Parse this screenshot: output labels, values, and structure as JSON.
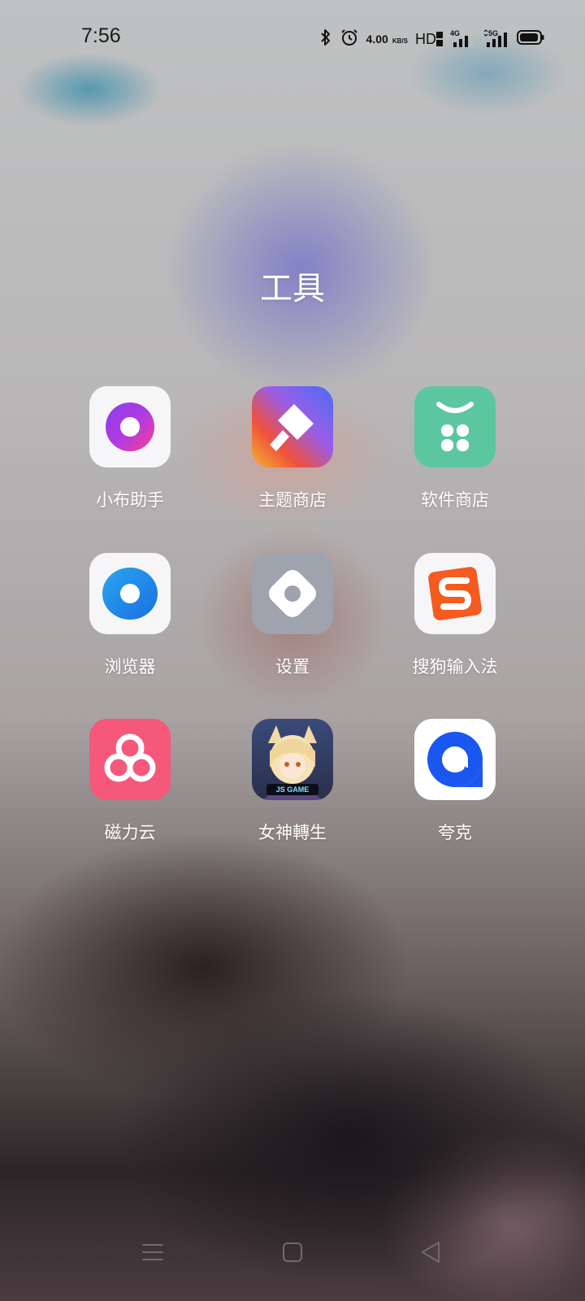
{
  "status_bar": {
    "time": "7:56",
    "net_speed_value": "4.00",
    "net_speed_unit": "KB/S",
    "hd_label": "HD",
    "signal_1_label": "4G",
    "signal_2_label": "5G",
    "icons": [
      "bluetooth-icon",
      "alarm-icon",
      "hd-volte-icon",
      "signal-4g-icon",
      "signal-5g-icon",
      "battery-icon"
    ]
  },
  "folder": {
    "title": "工具",
    "apps": [
      {
        "label": "小布助手",
        "icon": "xiaobu-assistant-icon"
      },
      {
        "label": "主题商店",
        "icon": "theme-store-icon"
      },
      {
        "label": "软件商店",
        "icon": "app-store-icon"
      },
      {
        "label": "浏览器",
        "icon": "browser-icon"
      },
      {
        "label": "设置",
        "icon": "settings-icon"
      },
      {
        "label": "搜狗输入法",
        "icon": "sogou-input-icon"
      },
      {
        "label": "磁力云",
        "icon": "cili-cloud-icon"
      },
      {
        "label": "女神轉生",
        "icon": "goddess-rebirth-icon",
        "badge": "JS GAME"
      },
      {
        "label": "夸克",
        "icon": "quark-icon"
      }
    ]
  },
  "nav_bar": {
    "icons": [
      "menu-icon",
      "home-icon",
      "back-icon"
    ]
  },
  "colors": {
    "text": "#ffffff",
    "app_store_green": "#5cc6a0",
    "browser_blue": "#1f8fe8",
    "sogou_orange": "#f55a1f",
    "cloud_pink": "#f5587a",
    "quark_blue": "#1a56f0"
  }
}
